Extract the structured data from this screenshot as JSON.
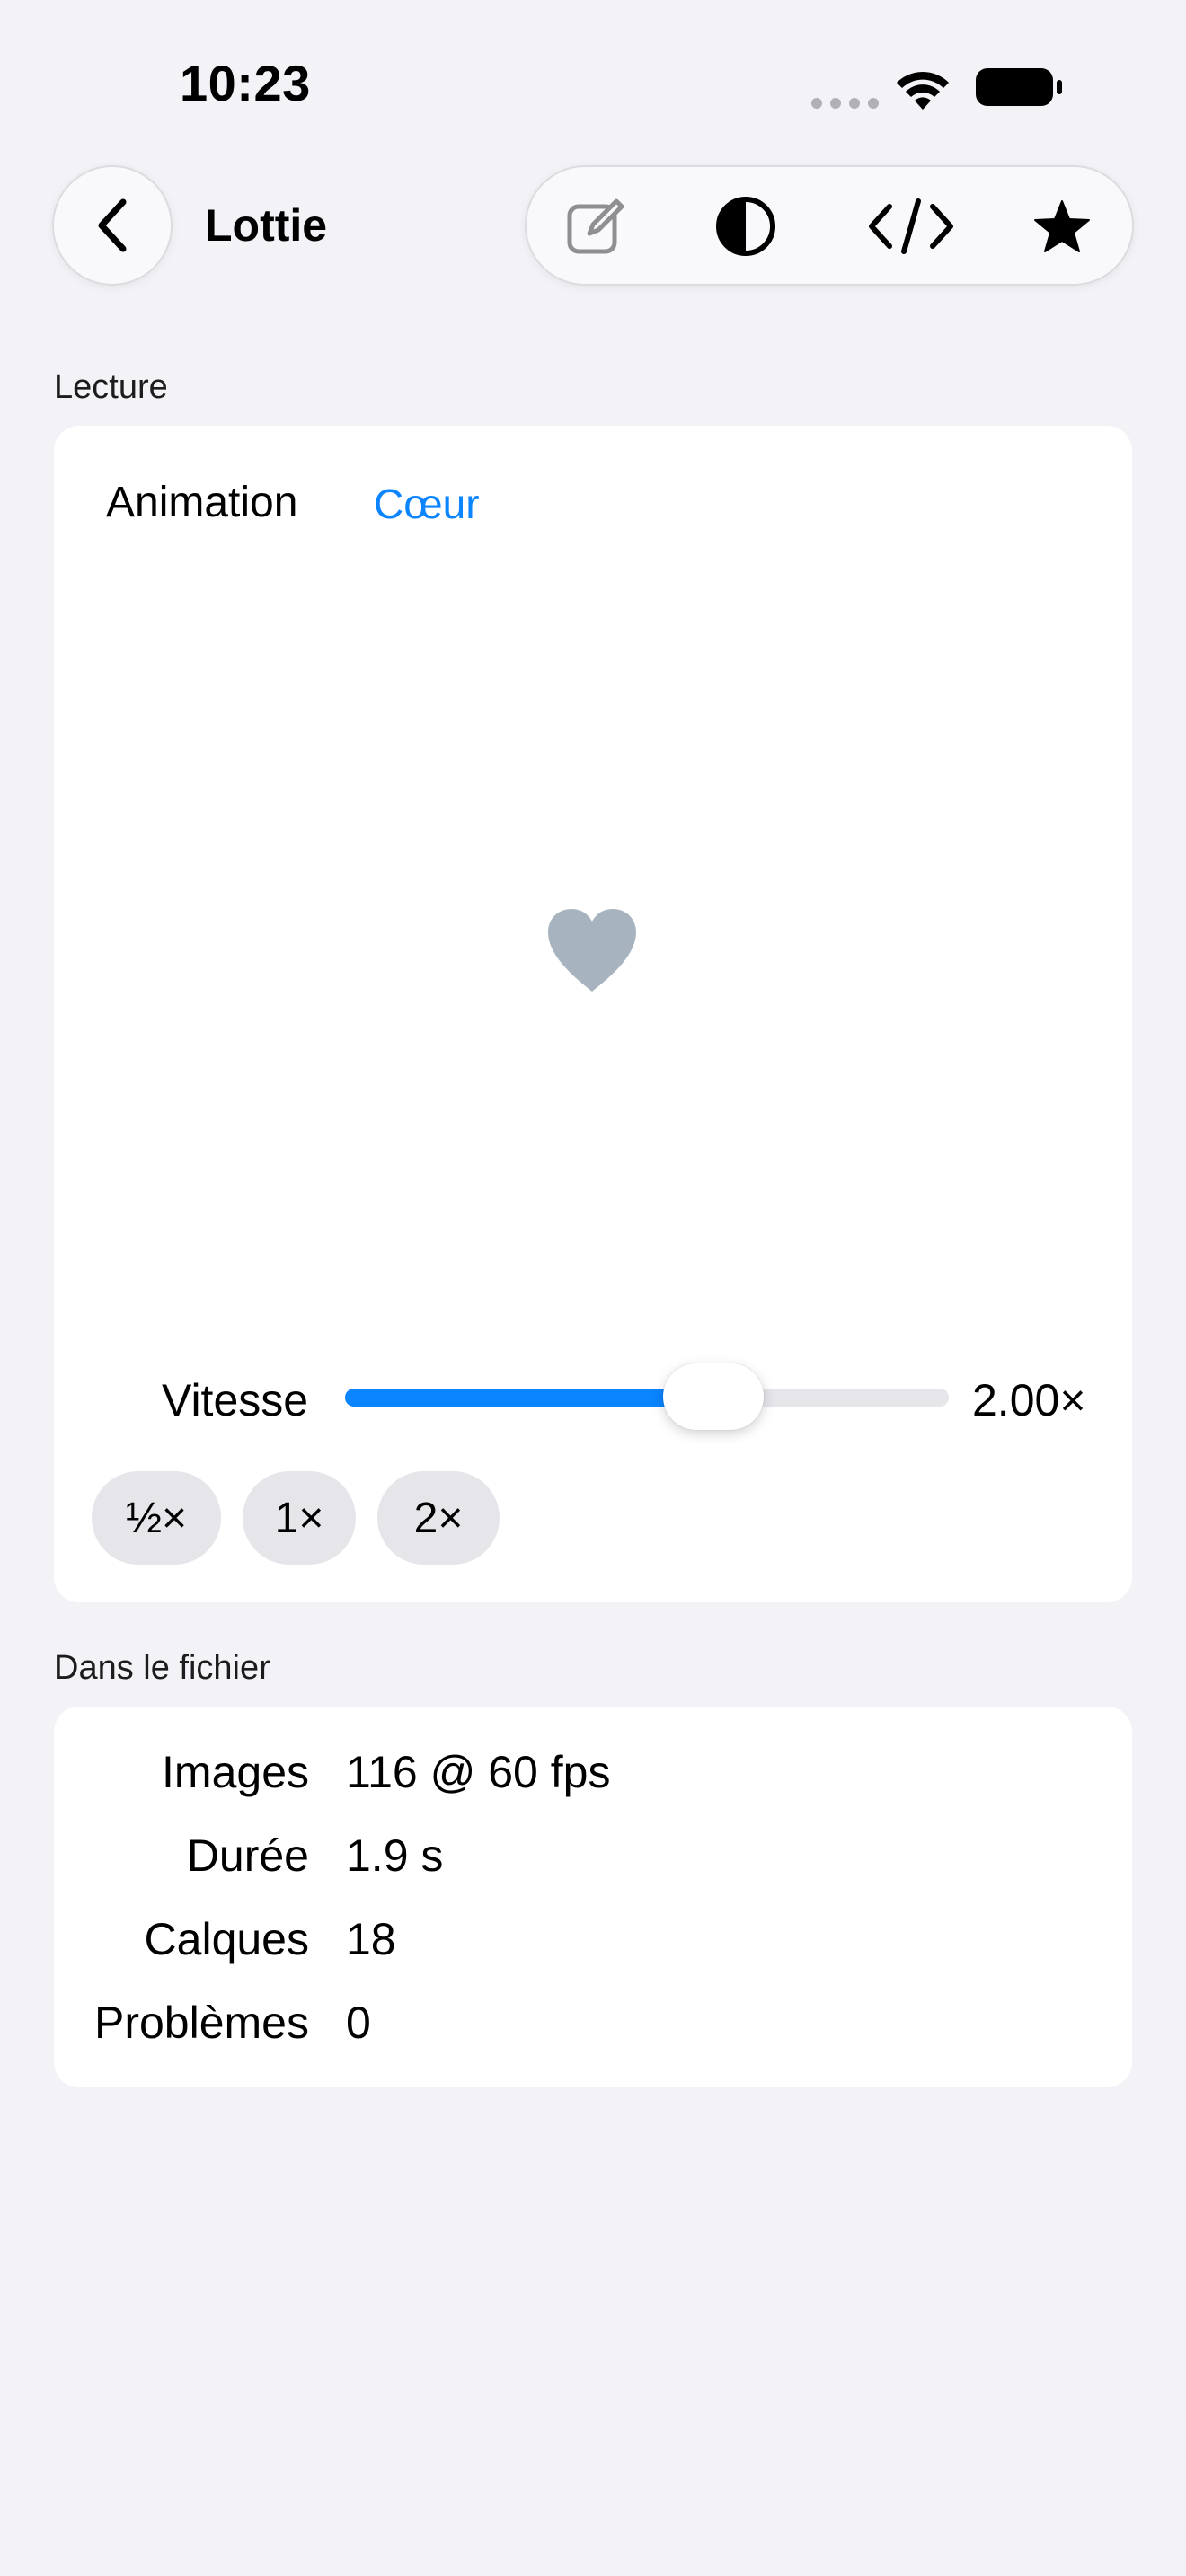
{
  "status_bar": {
    "time": "10:23"
  },
  "nav": {
    "back_icon": "chevron-left-icon",
    "title": "Lottie",
    "toolbar_icons": [
      "compose-icon",
      "contrast-icon",
      "code-icon",
      "star-icon"
    ]
  },
  "playback": {
    "section_title": "Lecture",
    "animation_label": "Animation",
    "animation_value": "Cœur",
    "preview_icon": "heart-icon",
    "speed_label": "Vitesse",
    "speed_value": "2.00×",
    "speed_fraction": 0.61,
    "presets": [
      "½×",
      "1×",
      "2×"
    ]
  },
  "file_info": {
    "section_title": "Dans le fichier",
    "rows": [
      {
        "label": "Images",
        "value": "116 @ 60 fps"
      },
      {
        "label": "Durée",
        "value": "1.9 s"
      },
      {
        "label": "Calques",
        "value": "18"
      },
      {
        "label": "Problèmes",
        "value": "0"
      }
    ]
  },
  "colors": {
    "accent": "#0a84ff",
    "background": "#f2f2f7",
    "card": "#ffffff",
    "heart": "#a7b4bf",
    "pill": "#e5e5ea"
  }
}
